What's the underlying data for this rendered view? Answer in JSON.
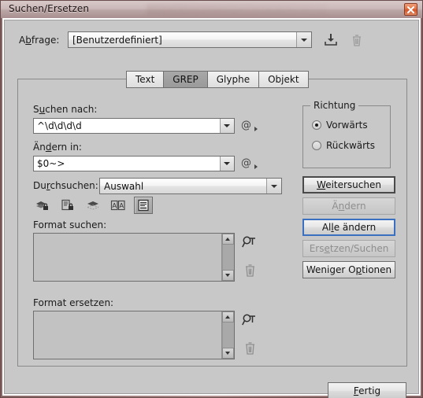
{
  "window": {
    "title": "Suchen/Ersetzen",
    "close_icon": "close-icon"
  },
  "query_row": {
    "label": "Abfrage:",
    "label_mnemonic": "b",
    "value": "[Benutzerdefiniert]",
    "save_icon": "save-query-icon",
    "delete_icon": "trash-icon"
  },
  "tabs": [
    {
      "label": "Text",
      "active": false
    },
    {
      "label": "GREP",
      "active": true
    },
    {
      "label": "Glyphe",
      "active": false
    },
    {
      "label": "Objekt",
      "active": false
    }
  ],
  "find": {
    "label": "Suchen nach:",
    "value": "^\\d\\d\\d\\d",
    "special_char_icon": "at-menu-icon"
  },
  "change": {
    "label": "Ändern in:",
    "value": "$0~>",
    "special_char_icon": "at-menu-icon"
  },
  "search_scope": {
    "label": "Durchsuchen:",
    "value": "Auswahl"
  },
  "scope_toggles": [
    {
      "name": "include-locked-layers-icon",
      "active": false
    },
    {
      "name": "include-locked-stories-icon",
      "active": false
    },
    {
      "name": "include-hidden-layers-icon",
      "active": false
    },
    {
      "name": "include-master-pages-icon",
      "active": false
    },
    {
      "name": "include-footnotes-icon",
      "active": true
    }
  ],
  "format_find": {
    "label": "Format suchen:",
    "content": "",
    "find_icon": "find-format-icon",
    "clear_icon": "trash-icon"
  },
  "format_replace": {
    "label": "Format ersetzen:",
    "content": "",
    "find_icon": "find-format-icon",
    "clear_icon": "trash-icon"
  },
  "direction": {
    "legend": "Richtung",
    "options": [
      {
        "label": "Vorwärts",
        "checked": true
      },
      {
        "label": "Rückwärts",
        "checked": false
      }
    ]
  },
  "buttons": {
    "find_next": {
      "label": "Weitersuchen",
      "state": "default"
    },
    "change": {
      "label": "Ändern",
      "state": "disabled"
    },
    "change_all": {
      "label": "Alle ändern",
      "state": "focus"
    },
    "change_find": {
      "label": "Ersetzen/Suchen",
      "state": "disabled"
    },
    "fewer_options": {
      "label": "Weniger Optionen",
      "state": "normal"
    },
    "done": {
      "label": "Fertig",
      "state": "normal"
    }
  },
  "colors": {
    "dialog_bg": "#c8c8c8",
    "titlebar_top": "#d8c9c9",
    "titlebar_bottom": "#a98f8f",
    "frame_border": "#6b4c4c",
    "close_button": "#d4542a",
    "focus_ring": "#3b6fbf",
    "field_bg": "#ffffff",
    "disabled_text": "#8e8e8e"
  }
}
